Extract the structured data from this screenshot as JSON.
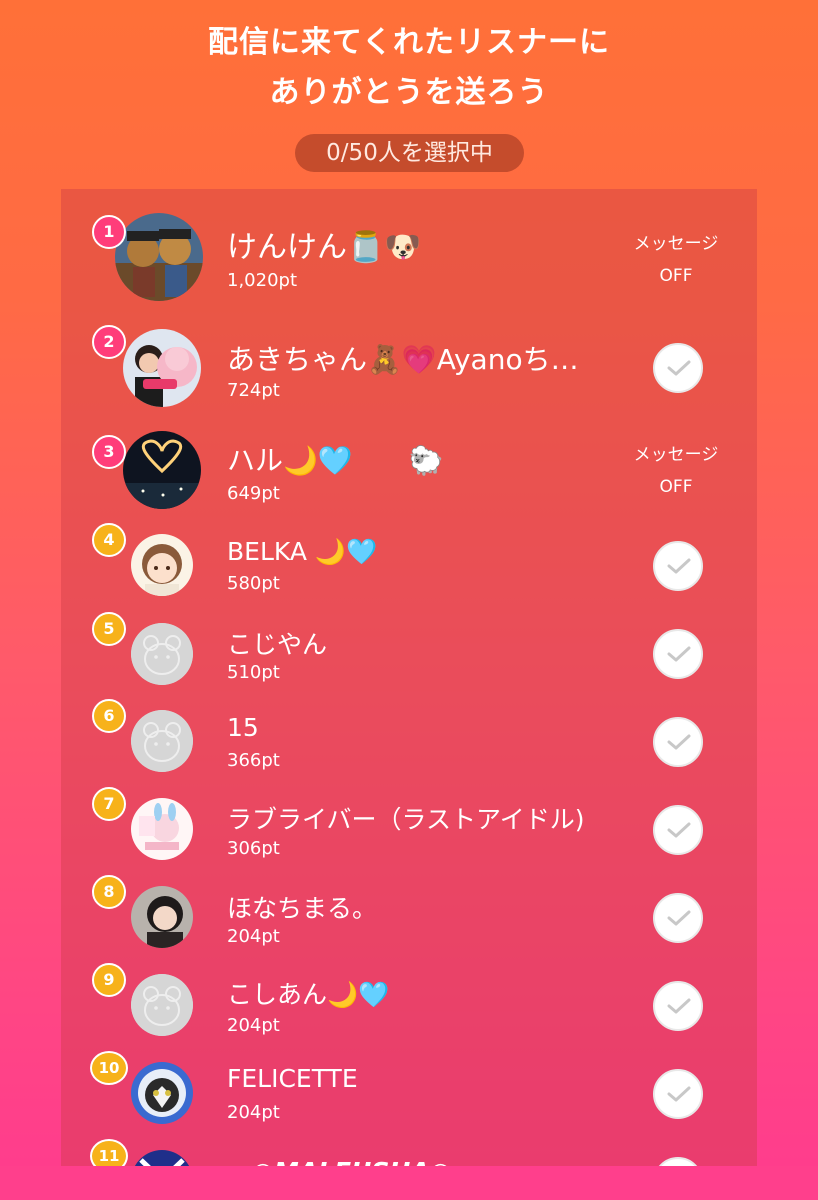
{
  "header": {
    "title_line1": "配信に来てくれたリスナーに",
    "title_line2": "ありがとうを送ろう",
    "selection_count": "0/50人を選択中"
  },
  "message_off_label_line1": "メッセージ",
  "message_off_label_line2": "OFF",
  "listeners": [
    {
      "rank": "1",
      "name": "けんけん🫙🐶",
      "points": "1,020pt",
      "status": "message-off",
      "avatar": "pirate-dogs"
    },
    {
      "rank": "2",
      "name": "あきちゃん🧸💗Ayanoち…",
      "points": "724pt",
      "status": "check",
      "avatar": "girl-with-plush"
    },
    {
      "rank": "3",
      "name": "ハル🌙🩵　　🐑",
      "points": "649pt",
      "status": "message-off",
      "avatar": "heart-lights"
    },
    {
      "rank": "4",
      "name": "BELKA 🌙🩵",
      "points": "580pt",
      "status": "check",
      "avatar": "anime-girl"
    },
    {
      "rank": "5",
      "name": "こじやん",
      "points": "510pt",
      "status": "check",
      "avatar": "default-bear"
    },
    {
      "rank": "6",
      "name": "15",
      "points": "366pt",
      "status": "check",
      "avatar": "default-bear"
    },
    {
      "rank": "7",
      "name": "ラブライバー（ラストアイドル)",
      "points": "306pt",
      "status": "check",
      "avatar": "idol-sticker"
    },
    {
      "rank": "8",
      "name": "ほなちまる。",
      "points": "204pt",
      "status": "check",
      "avatar": "girl-photo"
    },
    {
      "rank": "9",
      "name": "こしあん🌙🩵",
      "points": "204pt",
      "status": "check",
      "avatar": "default-bear"
    },
    {
      "rank": "10",
      "name": "FELICETTE",
      "points": "204pt",
      "status": "check",
      "avatar": "cat-astronaut"
    },
    {
      "rank": "11",
      "name": "～○MALFUSHA○～",
      "points": "",
      "status": "check",
      "avatar": "blue-logo"
    }
  ],
  "colors": {
    "rank_top": "#ff3d7a",
    "rank_normal": "#f7b21a",
    "check_mark": "#c8c8c8"
  }
}
